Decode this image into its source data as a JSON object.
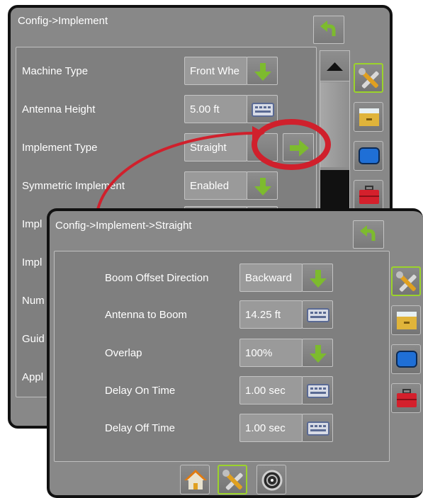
{
  "back_panel": {
    "title": "Config->Implement",
    "rows": [
      {
        "label": "Machine Type",
        "value": "Front Whe"
      },
      {
        "label": "Antenna Height",
        "value": "5.00 ft"
      },
      {
        "label": "Implement Type",
        "value": "Straight"
      },
      {
        "label": "Symmetric Implement",
        "value": "Enabled"
      },
      {
        "label": "Impl"
      },
      {
        "label": "Impl"
      },
      {
        "label": "Num"
      },
      {
        "label": "Guid"
      },
      {
        "label": "Appl"
      }
    ]
  },
  "front_panel": {
    "title": "Config->Implement->Straight",
    "rows": [
      {
        "label": "Boom Offset Direction",
        "value": "Backward"
      },
      {
        "label": "Antenna to Boom",
        "value": "14.25 ft"
      },
      {
        "label": "Overlap",
        "value": "100%"
      },
      {
        "label": "Delay On Time",
        "value": "1.00 sec"
      },
      {
        "label": "Delay Off Time",
        "value": "1.00 sec"
      }
    ]
  },
  "colors": {
    "accent_green": "#7dbb2e",
    "highlight_red": "#d0202c",
    "active_border": "#9bd32b"
  },
  "icons": [
    "back-arrow-icon",
    "down-arrow-icon",
    "keyboard-icon",
    "right-arrow-icon",
    "tools-icon",
    "drawer-icon",
    "monitor-icon",
    "toolbox-icon",
    "home-icon",
    "gauge-icon",
    "scroll-up-icon"
  ]
}
